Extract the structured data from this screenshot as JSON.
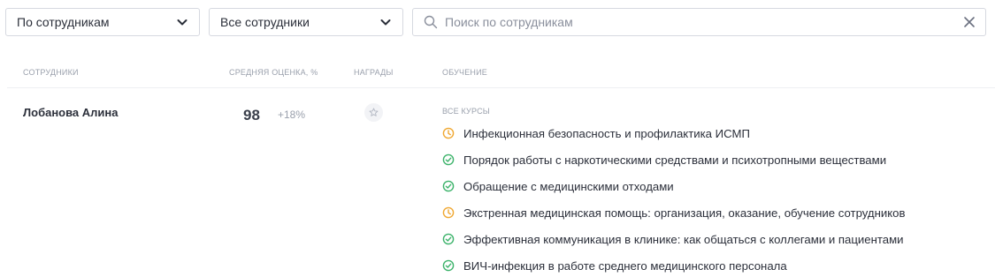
{
  "filters": {
    "mode_value": "По сотрудникам",
    "staff_value": "Все сотрудники"
  },
  "search": {
    "placeholder": "Поиск по сотрудникам",
    "value": ""
  },
  "table": {
    "columns": {
      "staff": "Сотрудники",
      "score": "Средняя оценка, %",
      "awards": "Награды",
      "learning": "Обучение"
    },
    "rows": [
      {
        "name": "Лобанова Алина",
        "score": "98",
        "delta": "+18%",
        "courses_title": "Все курсы",
        "courses": [
          {
            "title": "Инфекционная безопасность и профилактика ИСМП",
            "status": "in-progress"
          },
          {
            "title": "Порядок работы с наркотическими средствами и психотропными веществами",
            "status": "completed"
          },
          {
            "title": "Обращение с медицинскими отходами",
            "status": "completed"
          },
          {
            "title": "Экстренная медицинская помощь: организация, оказание, обучение сотрудников",
            "status": "in-progress"
          },
          {
            "title": "Эффективная коммуникация в клинике: как общаться с коллегами и пациентами",
            "status": "completed"
          },
          {
            "title": "ВИЧ-инфекция в работе среднего медицинского персонала",
            "status": "completed"
          }
        ]
      }
    ]
  },
  "colors": {
    "completed": "#3db36b",
    "in_progress": "#f0a832",
    "muted": "#9aa0ac"
  },
  "icons": {
    "completed": "check-circle-icon",
    "in_progress": "clock-icon",
    "award": "star-icon"
  }
}
